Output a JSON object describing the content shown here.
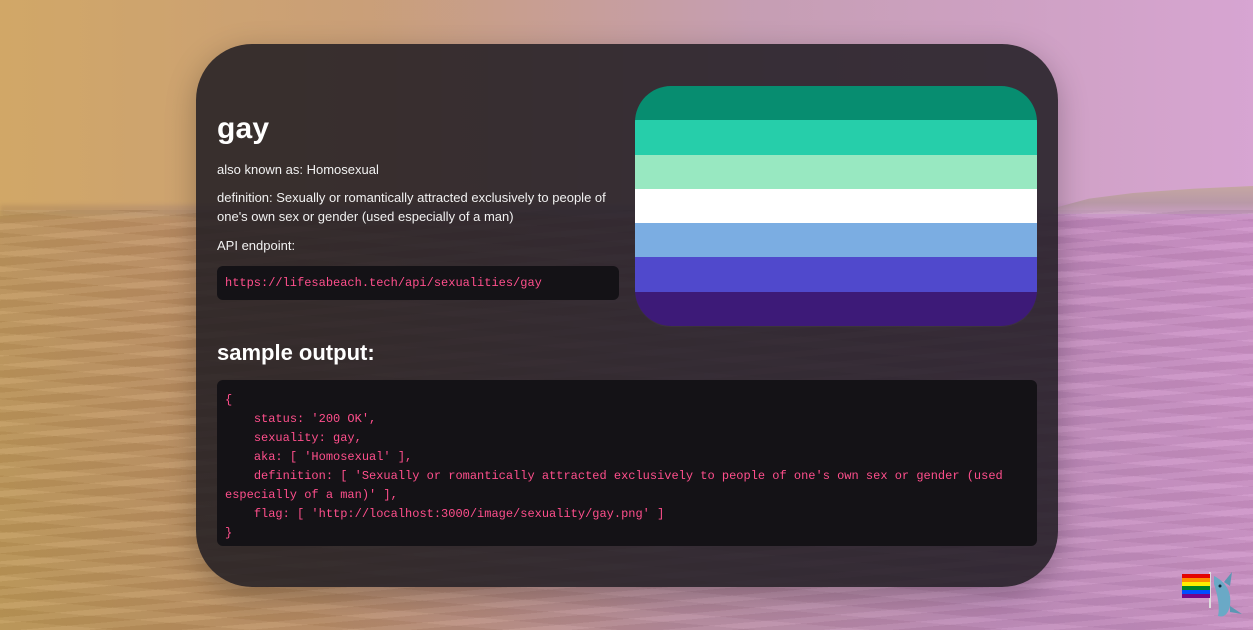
{
  "page": {
    "title": "gay",
    "also_known_as": "also known as: Homosexual",
    "definition": "definition: Sexually or romantically attracted exclusively to people of one's own sex or gender (used especially of a man)",
    "api_label": "API endpoint:",
    "endpoint_url": "https://lifesabeach.tech/api/sexualities/gay",
    "sample_title": "sample output:",
    "sample_output": "{\n    status: '200 OK',\n    sexuality: gay,\n    aka: [ 'Homosexual' ],\n    definition: [ 'Sexually or romantically attracted exclusively to people of one's own sex or gender (used especially of a man)' ],\n    flag: [ 'http://localhost:3000/image/sexuality/gay.png' ]\n}"
  },
  "flag": {
    "stripes": [
      "#078D70",
      "#26CEAA",
      "#98E8C1",
      "#FFFFFF",
      "#7BADE2",
      "#5049CC",
      "#3D1A78"
    ]
  },
  "decor": {
    "mascot_icon": "shark-with-rainbow-flag-icon"
  },
  "colors": {
    "code_text": "#ff4f8c",
    "card_bg": "#201c22"
  }
}
